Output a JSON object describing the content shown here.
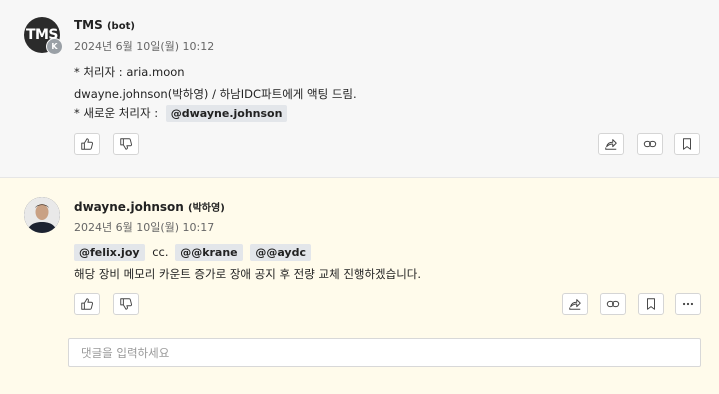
{
  "post1": {
    "avatar_text": "TMS",
    "avatar_badge": "K",
    "author": "TMS",
    "author_suffix": "(bot)",
    "timestamp": "2024년 6월 10일(월) 10:12",
    "line1": "* 처리자 : aria.moon",
    "line2": "dwayne.johnson(박하영) / 하남IDC파트에게 액팅 드림.",
    "line3_prefix": "* 새로운 처리자 :",
    "line3_mention": "@dwayne.johnson"
  },
  "post2": {
    "author": "dwayne.johnson",
    "author_suffix": "(박하영)",
    "timestamp": "2024년 6월 10일(월) 10:17",
    "mention1": "@felix.joy",
    "cc_text": "cc.",
    "mention2": "@@krane",
    "mention3": "@@aydc",
    "body": "해당 장비 메모리 카운트 증가로 장애 공지 후 전량 교체 진행하겠습니다."
  },
  "comment": {
    "placeholder": "댓글을 입력하세요"
  },
  "icons": [
    "thumbs-up-icon",
    "thumbs-down-icon",
    "share-icon",
    "link-icon",
    "bookmark-icon",
    "more-icon"
  ]
}
